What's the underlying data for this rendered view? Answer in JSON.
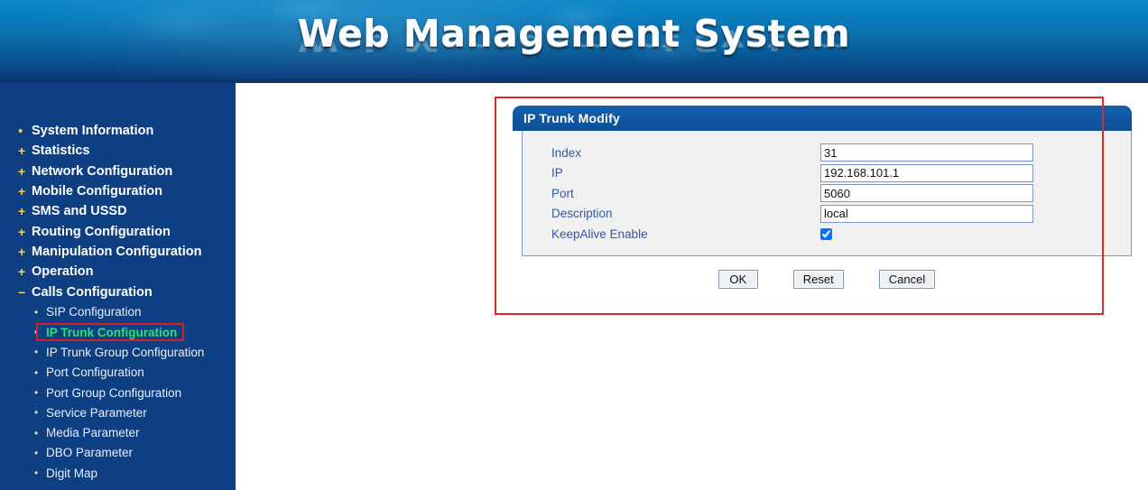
{
  "banner": {
    "title": "Web Management System",
    "reflection": "Web Management System"
  },
  "sidebar": {
    "items": [
      {
        "label": "System Information",
        "marker": "•"
      },
      {
        "label": "Statistics",
        "marker": "+"
      },
      {
        "label": "Network Configuration",
        "marker": "+"
      },
      {
        "label": "Mobile Configuration",
        "marker": "+"
      },
      {
        "label": "SMS and USSD",
        "marker": "+"
      },
      {
        "label": "Routing Configuration",
        "marker": "+"
      },
      {
        "label": "Manipulation Configuration",
        "marker": "+"
      },
      {
        "label": "Operation",
        "marker": "+"
      },
      {
        "label": "Calls Configuration",
        "marker": "−"
      }
    ],
    "subitems": [
      {
        "label": "SIP Configuration",
        "bullet": "•",
        "selected": false
      },
      {
        "label": "IP Trunk Configuration",
        "bullet": "•",
        "selected": true
      },
      {
        "label": "IP Trunk Group Configuration",
        "bullet": "•",
        "selected": false
      },
      {
        "label": "Port Configuration",
        "bullet": "•",
        "selected": false
      },
      {
        "label": "Port Group Configuration",
        "bullet": "•",
        "selected": false
      },
      {
        "label": "Service Parameter",
        "bullet": "•",
        "selected": false
      },
      {
        "label": "Media Parameter",
        "bullet": "•",
        "selected": false
      },
      {
        "label": "DBO Parameter",
        "bullet": "•",
        "selected": false
      },
      {
        "label": "Digit Map",
        "bullet": "•",
        "selected": false
      }
    ]
  },
  "dialog": {
    "title": "IP Trunk Modify",
    "fields": {
      "index": {
        "label": "Index",
        "value": "31"
      },
      "ip": {
        "label": "IP",
        "value": "192.168.101.1"
      },
      "port": {
        "label": "Port",
        "value": "5060"
      },
      "description": {
        "label": "Description",
        "value": "local"
      },
      "keepalive": {
        "label": "KeepAlive Enable",
        "checked": true
      }
    },
    "buttons": {
      "ok": "OK",
      "reset": "Reset",
      "cancel": "Cancel"
    }
  },
  "colors": {
    "banner_top": "#0d86c8",
    "banner_bottom": "#0a3570",
    "sidebar_bg": "#0d3f82",
    "menu_marker": "#ffd24d",
    "selected_item": "#2ee07a",
    "annotation_red": "#e02727",
    "dialog_header": "#0f58a4",
    "field_label": "#33589f"
  }
}
